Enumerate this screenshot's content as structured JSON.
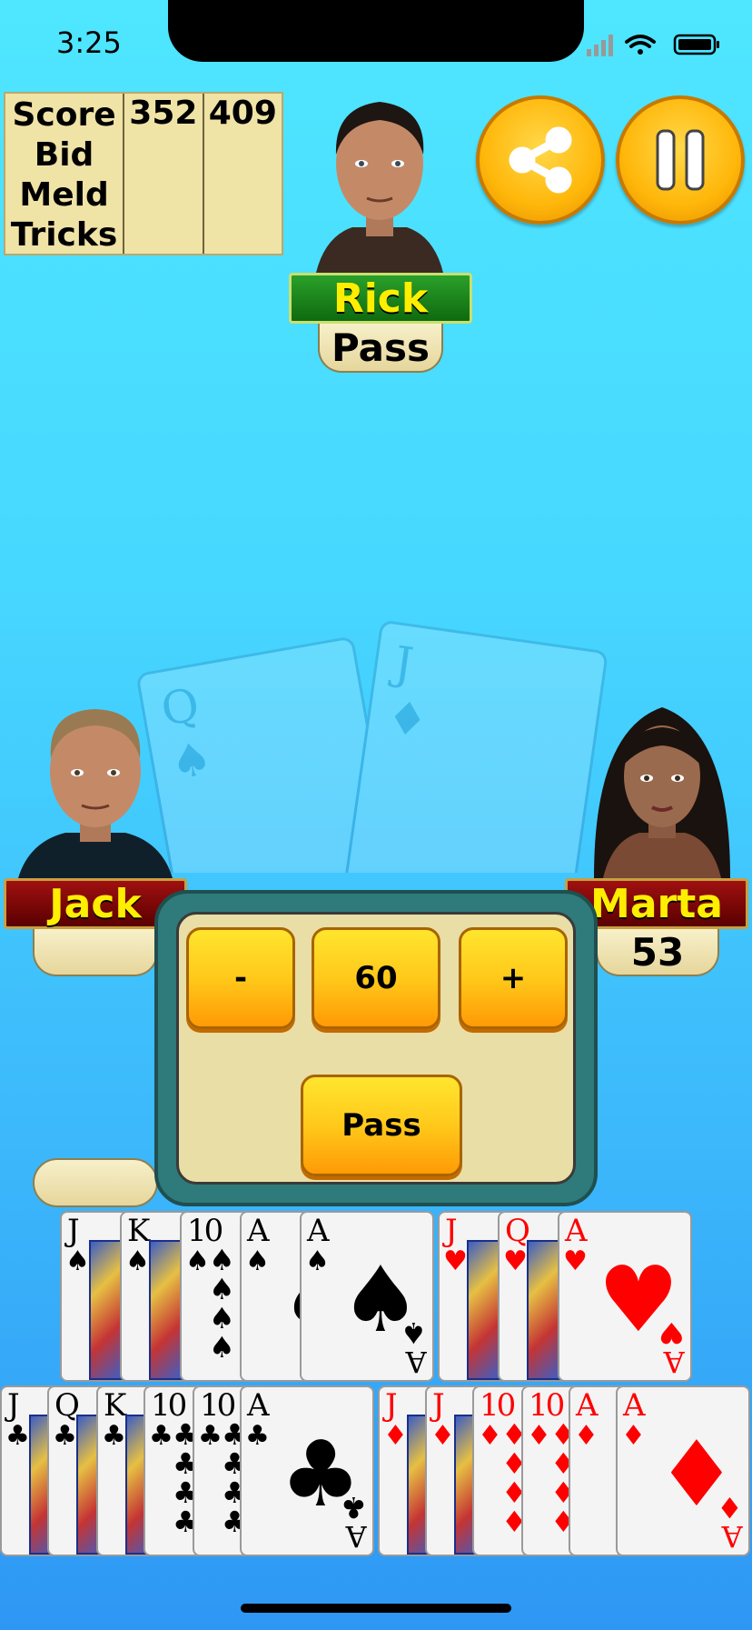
{
  "status_bar": {
    "time": "3:25"
  },
  "scoreboard": {
    "labels": [
      "Score",
      "Bid",
      "Meld",
      "Tricks"
    ],
    "team_a_score": "352",
    "team_b_score": "409"
  },
  "players": {
    "top": {
      "name": "Rick",
      "bid": "Pass"
    },
    "left": {
      "name": "Jack",
      "bid": ""
    },
    "right": {
      "name": "Marta",
      "bid": "53"
    }
  },
  "bid_panel": {
    "minus_label": "-",
    "value": "60",
    "plus_label": "+",
    "pass_label": "Pass"
  },
  "hand": {
    "row1": [
      {
        "rank": "J",
        "suit": "♠",
        "color": "black",
        "type": "face"
      },
      {
        "rank": "K",
        "suit": "♠",
        "color": "black",
        "type": "face"
      },
      {
        "rank": "10",
        "suit": "♠",
        "color": "black",
        "type": "pips"
      },
      {
        "rank": "A",
        "suit": "♠",
        "color": "black",
        "type": "ace"
      },
      {
        "rank": "A",
        "suit": "♠",
        "color": "black",
        "type": "ace"
      },
      {
        "rank": "J",
        "suit": "♥",
        "color": "red",
        "type": "face"
      },
      {
        "rank": "Q",
        "suit": "♥",
        "color": "red",
        "type": "face"
      },
      {
        "rank": "A",
        "suit": "♥",
        "color": "red",
        "type": "ace"
      }
    ],
    "row2": [
      {
        "rank": "J",
        "suit": "♣",
        "color": "black",
        "type": "face"
      },
      {
        "rank": "Q",
        "suit": "♣",
        "color": "black",
        "type": "face"
      },
      {
        "rank": "K",
        "suit": "♣",
        "color": "black",
        "type": "face"
      },
      {
        "rank": "10",
        "suit": "♣",
        "color": "black",
        "type": "pips"
      },
      {
        "rank": "10",
        "suit": "♣",
        "color": "black",
        "type": "pips"
      },
      {
        "rank": "A",
        "suit": "♣",
        "color": "black",
        "type": "ace"
      },
      {
        "rank": "J",
        "suit": "♦",
        "color": "red",
        "type": "face"
      },
      {
        "rank": "J",
        "suit": "♦",
        "color": "red",
        "type": "face"
      },
      {
        "rank": "10",
        "suit": "♦",
        "color": "red",
        "type": "pips"
      },
      {
        "rank": "10",
        "suit": "♦",
        "color": "red",
        "type": "pips"
      },
      {
        "rank": "A",
        "suit": "♦",
        "color": "red",
        "type": "ace"
      },
      {
        "rank": "A",
        "suit": "♦",
        "color": "red",
        "type": "ace"
      }
    ]
  },
  "colors": {
    "accent_orange": "#ffb70a",
    "name_plate_green": "#1f8a1f",
    "name_plate_red": "#8a0a0a",
    "name_text": "#ffee00"
  }
}
